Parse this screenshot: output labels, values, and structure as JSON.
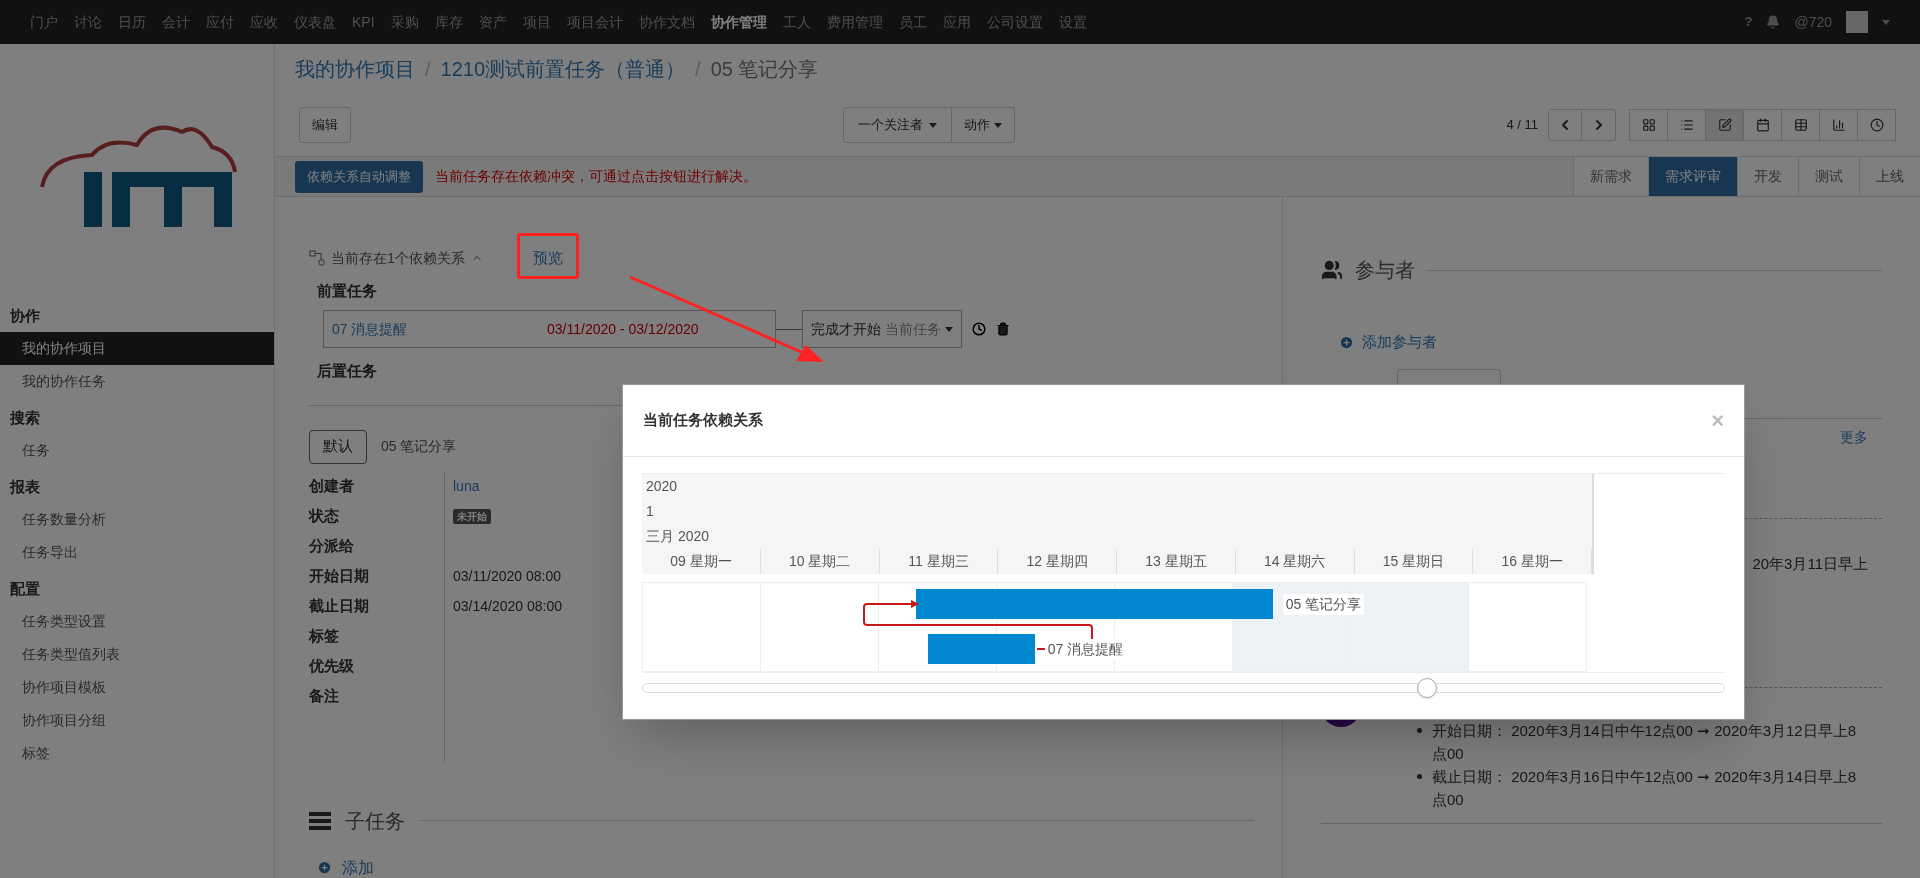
{
  "top_nav": {
    "items": [
      {
        "label": "门户",
        "selected": false
      },
      {
        "label": "讨论",
        "selected": false
      },
      {
        "label": "日历",
        "selected": false
      },
      {
        "label": "会计",
        "selected": false
      },
      {
        "label": "应付",
        "selected": false
      },
      {
        "label": "应收",
        "selected": false
      },
      {
        "label": "仪表盘",
        "selected": false
      },
      {
        "label": "KPI",
        "selected": false
      },
      {
        "label": "采购",
        "selected": false
      },
      {
        "label": "库存",
        "selected": false
      },
      {
        "label": "资产",
        "selected": false
      },
      {
        "label": "项目",
        "selected": false
      },
      {
        "label": "项目会计",
        "selected": false
      },
      {
        "label": "协作文档",
        "selected": false
      },
      {
        "label": "协作管理",
        "selected": true
      },
      {
        "label": "工人",
        "selected": false
      },
      {
        "label": "费用管理",
        "selected": false
      },
      {
        "label": "员工",
        "selected": false
      },
      {
        "label": "应用",
        "selected": false
      },
      {
        "label": "公司设置",
        "selected": false
      },
      {
        "label": "设置",
        "selected": false
      }
    ],
    "help": "?",
    "user": "@720"
  },
  "sidebar": {
    "sections": [
      {
        "title": "协作",
        "items": [
          {
            "label": "我的协作项目",
            "selected": true
          },
          {
            "label": "我的协作任务",
            "selected": false
          }
        ]
      },
      {
        "title": "搜索",
        "items": [
          {
            "label": "任务",
            "selected": false
          }
        ]
      },
      {
        "title": "报表",
        "items": [
          {
            "label": "任务数量分析",
            "selected": false
          },
          {
            "label": "任务导出",
            "selected": false
          }
        ]
      },
      {
        "title": "配置",
        "items": [
          {
            "label": "任务类型设置",
            "selected": false
          },
          {
            "label": "任务类型值列表",
            "selected": false
          },
          {
            "label": "协作项目模板",
            "selected": false
          },
          {
            "label": "协作项目分组",
            "selected": false
          },
          {
            "label": "标签",
            "selected": false
          }
        ]
      }
    ]
  },
  "breadcrumb": [
    {
      "kind": "link",
      "text": "我的协作项目"
    },
    {
      "kind": "separator",
      "text": "/"
    },
    {
      "kind": "link",
      "text": "1210测试前置任务（普通）"
    },
    {
      "kind": "separator",
      "text": "/"
    },
    {
      "kind": "current",
      "text": "05 笔记分享"
    }
  ],
  "toolbar": {
    "edit": "编辑",
    "follow": "一个关注者",
    "action": "动作",
    "pager": "4 / 11",
    "views": [
      {
        "kind": "kanban",
        "selected": false
      },
      {
        "kind": "list",
        "selected": false
      },
      {
        "kind": "form",
        "selected": true
      },
      {
        "kind": "calendar",
        "selected": false
      },
      {
        "kind": "table",
        "selected": false
      },
      {
        "kind": "graph",
        "selected": false
      },
      {
        "kind": "activity",
        "selected": false
      }
    ]
  },
  "alert": {
    "button": "依赖关系自动调整",
    "message": "当前任务存在依赖冲突，可通过点击按钮进行解决。"
  },
  "stages": [
    {
      "label": "新需求",
      "selected": false
    },
    {
      "label": "需求评审",
      "selected": true
    },
    {
      "label": "开发",
      "selected": false
    },
    {
      "label": "测试",
      "selected": false
    },
    {
      "label": "上线",
      "selected": false
    }
  ],
  "dependency": {
    "summary": "当前存在1个依赖关系",
    "expanded": true,
    "preview": "预览",
    "predecessor_title": "前置任务",
    "predecessor": {
      "name": "07 消息提醒",
      "dates": "03/11/2020 - 03/12/2020",
      "relation": "完成才开始",
      "target": "当前任务"
    },
    "successor_title": "后置任务"
  },
  "task": {
    "default_button": "默认",
    "name": "05 笔记分享",
    "fields": [
      {
        "label": "创建者",
        "kind": "link",
        "value": "luna"
      },
      {
        "label": "状态",
        "kind": "badge",
        "value": "未开始"
      },
      {
        "label": "分派给",
        "kind": "empty"
      },
      {
        "label": "开始日期",
        "kind": "text",
        "value": "03/11/2020 08:00"
      },
      {
        "label": "截止日期",
        "kind": "text",
        "value": "03/14/2020 08:00"
      },
      {
        "label": "标签",
        "kind": "empty"
      },
      {
        "label": "优先级",
        "kind": "empty"
      },
      {
        "label": "备注",
        "kind": "empty"
      }
    ]
  },
  "subtasks": {
    "title": "子任务",
    "add": "添加"
  },
  "participants": {
    "title": "参与者",
    "add": "添加参与者",
    "more": "更多"
  },
  "activity": {
    "fragment": "20年3月11日早上",
    "changes": [
      "开始日期：  2020年3月14日中午12点00 ➞ 2020年3月12日早上8点00",
      "截止日期：  2020年3月16日中午12点00 ➞ 2020年3月14日早上8点00"
    ]
  },
  "modal": {
    "title": "当前任务依赖关系",
    "close": "×",
    "gantt": {
      "year": "2020",
      "week": "1",
      "month": "三月 2020",
      "days": [
        {
          "label": "09 星期一",
          "weekend": false
        },
        {
          "label": "10 星期二",
          "weekend": false
        },
        {
          "label": "11 星期三",
          "weekend": false
        },
        {
          "label": "12 星期四",
          "weekend": false
        },
        {
          "label": "13 星期五",
          "weekend": false
        },
        {
          "label": "14 星期六",
          "weekend": true
        },
        {
          "label": "15 星期日",
          "weekend": true
        },
        {
          "label": "16 星期一",
          "weekend": false
        }
      ],
      "tasks": [
        {
          "name": "05 笔记分享"
        },
        {
          "name": "07 消息提醒"
        }
      ],
      "zoom": {
        "level": 0.725
      }
    }
  }
}
